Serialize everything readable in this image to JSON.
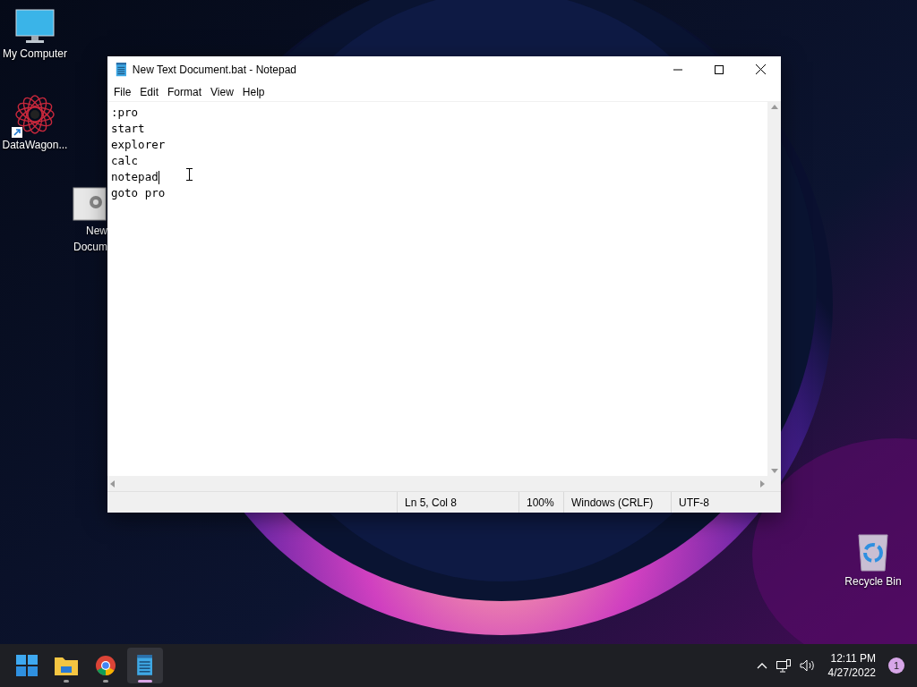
{
  "desktop_icons": [
    {
      "kind": "computer",
      "label_lines": [
        "My Computer"
      ],
      "shortcut": false
    },
    {
      "kind": "atom",
      "label_lines": [
        "DataWagon..."
      ],
      "shortcut": true
    },
    {
      "kind": "batch",
      "label_lines": [
        "New",
        "Docum"
      ],
      "shortcut": false
    },
    {
      "kind": "recycle",
      "label_lines": [
        "Recycle Bin"
      ],
      "shortcut": false
    }
  ],
  "window": {
    "title": "New Text Document.bat - Notepad",
    "menu": [
      "File",
      "Edit",
      "Format",
      "View",
      "Help"
    ],
    "lines": [
      {
        "text": ":pro",
        "caret": false
      },
      {
        "text": "start",
        "caret": false
      },
      {
        "text": "explorer",
        "caret": false
      },
      {
        "text": "calc",
        "caret": false
      },
      {
        "text": "notepad",
        "caret": true
      },
      {
        "text": "goto pro",
        "caret": false
      }
    ],
    "status_bar": [
      "Ln 5, Col 8",
      "100%",
      "Windows (CRLF)",
      "UTF-8"
    ]
  },
  "taskbar": {
    "apps": [
      {
        "kind": "start",
        "running": false,
        "selected": false
      },
      {
        "kind": "folder",
        "running": true,
        "selected": false
      },
      {
        "kind": "browser",
        "running": true,
        "selected": false
      },
      {
        "kind": "notepad",
        "running": true,
        "selected": true
      }
    ],
    "time": "12:11 PM",
    "date": "4/27/2022",
    "notifications": "1"
  }
}
